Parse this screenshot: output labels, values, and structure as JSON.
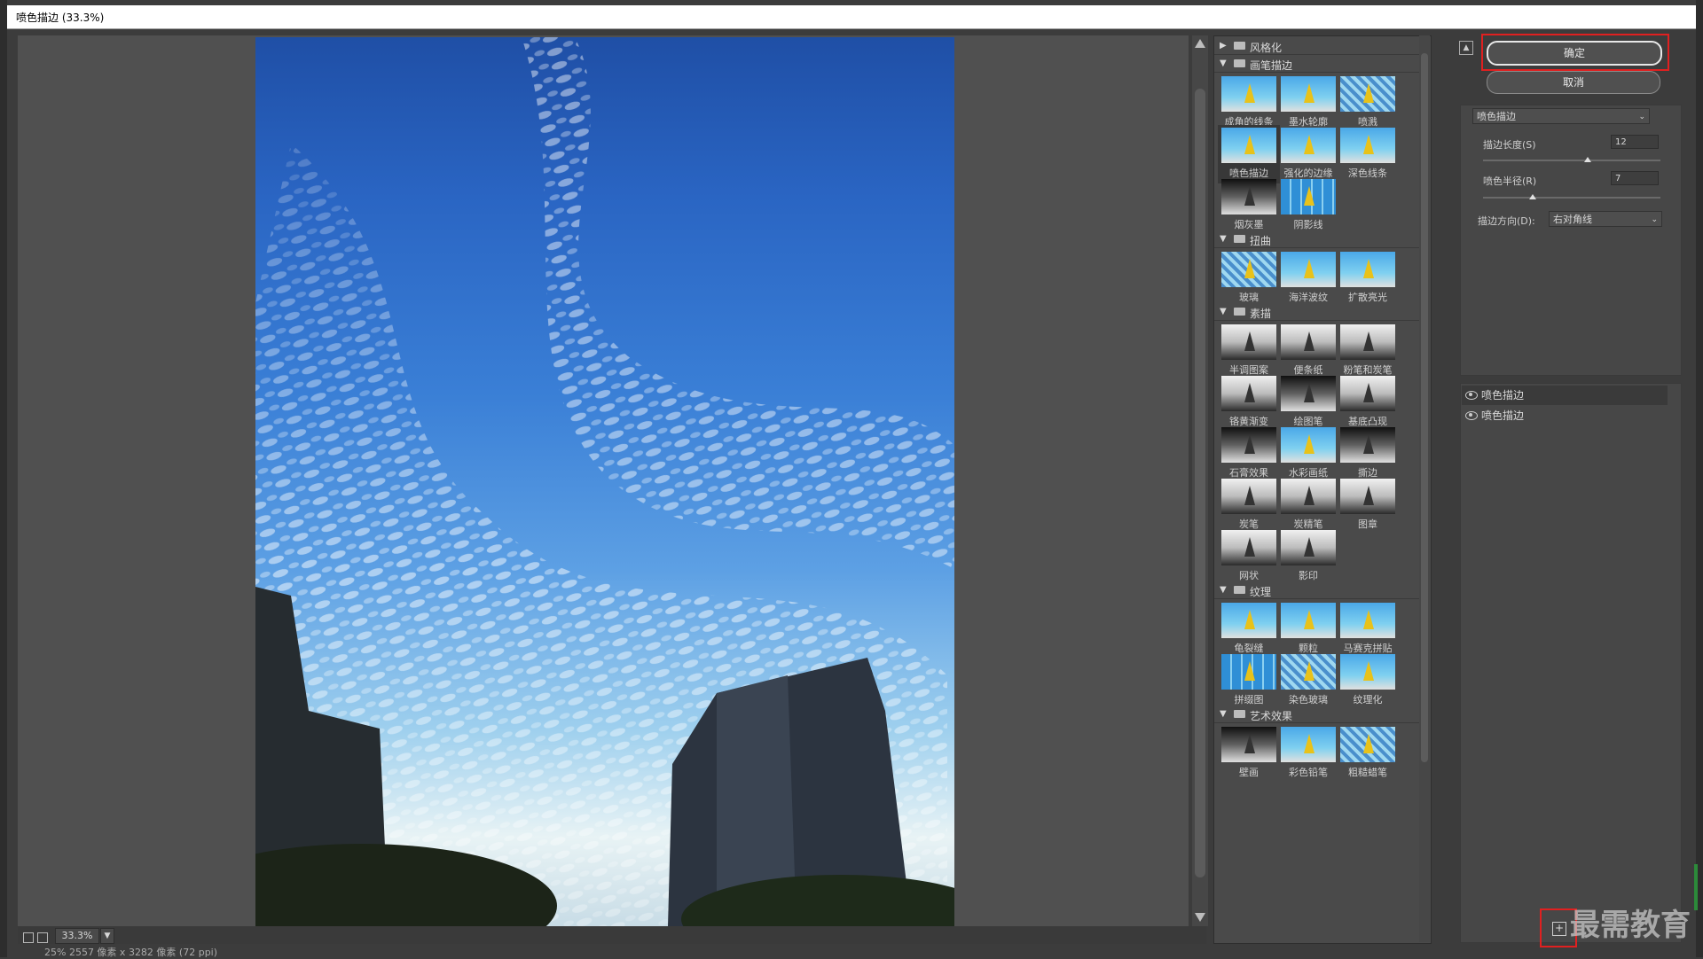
{
  "window": {
    "title": "喷色描边 (33.3%)"
  },
  "preview": {
    "zoom": "33.3%",
    "doc_info": "25% 2557 像素 x 3282 像素 (72 ppi)"
  },
  "gallery": {
    "categories": [
      {
        "name": "风格化",
        "expanded": false,
        "items": []
      },
      {
        "name": "画笔描边",
        "expanded": true,
        "items": [
          "成角的线条",
          "墨水轮廓",
          "喷溅",
          "喷色描边",
          "强化的边缘",
          "深色线条",
          "烟灰墨",
          "阴影线"
        ]
      },
      {
        "name": "扭曲",
        "expanded": true,
        "items": [
          "玻璃",
          "海洋波纹",
          "扩散亮光"
        ]
      },
      {
        "name": "素描",
        "expanded": true,
        "items": [
          "半调图案",
          "便条纸",
          "粉笔和炭笔",
          "铬黄渐变",
          "绘图笔",
          "基底凸现",
          "石膏效果",
          "水彩画纸",
          "撕边",
          "炭笔",
          "炭精笔",
          "图章",
          "网状",
          "影印"
        ]
      },
      {
        "name": "纹理",
        "expanded": true,
        "items": [
          "龟裂缝",
          "颗粒",
          "马赛克拼贴",
          "拼缀图",
          "染色玻璃",
          "纹理化"
        ]
      },
      {
        "name": "艺术效果",
        "expanded": true,
        "items": [
          "壁画",
          "彩色铅笔",
          "粗糙蜡笔"
        ]
      }
    ],
    "selected": "喷色描边"
  },
  "buttons": {
    "ok": "确定",
    "cancel": "取消"
  },
  "settings": {
    "filter": "喷色描边",
    "stroke_length_label": "描边长度(S)",
    "stroke_length_value": "12",
    "spray_radius_label": "喷色半径(R)",
    "spray_radius_value": "7",
    "direction_label": "描边方向(D):",
    "direction_value": "右对角线"
  },
  "layers": [
    "喷色描边",
    "喷色描边"
  ],
  "watermark": "最需教育",
  "colors": {
    "highlight": "#e02020",
    "panel": "#4a4a4a",
    "sky": "#2a65c3"
  }
}
